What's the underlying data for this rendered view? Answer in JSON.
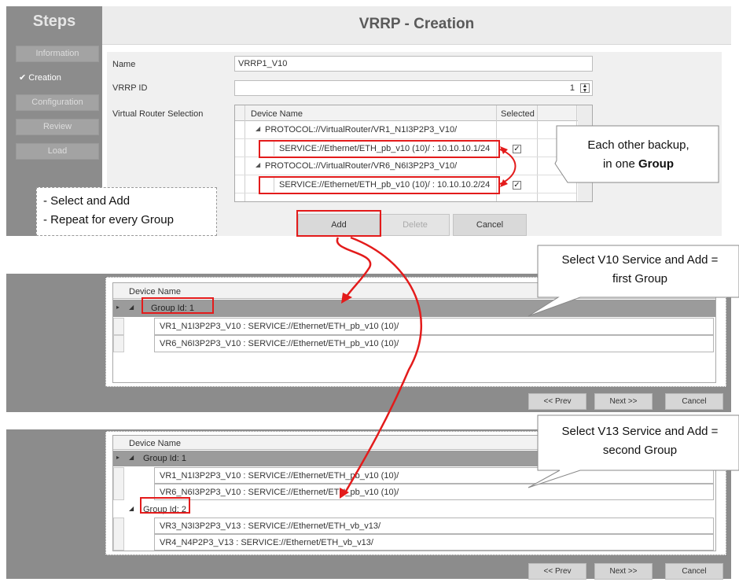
{
  "steps": {
    "title": "Steps",
    "items": [
      "Information",
      "Creation",
      "Configuration",
      "Review",
      "Load"
    ],
    "current_index": 1,
    "check_glyph": "✔"
  },
  "form": {
    "title": "VRRP - Creation",
    "name_label": "Name",
    "name_value": "VRRP1_V10",
    "vrrp_id_label": "VRRP ID",
    "vrrp_id_value": "1",
    "vrs_label": "Virtual Router Selection",
    "col_device": "Device Name",
    "col_selected": "Selected",
    "rows": [
      {
        "text": "PROTOCOL://VirtualRouter/VR1_N1I3P2P3_V10/",
        "kind": "protocol"
      },
      {
        "text": "SERVICE://Ethernet/ETH_pb_v10 (10)/ : 10.10.10.1/24",
        "kind": "service",
        "checked": true
      },
      {
        "text": "PROTOCOL://VirtualRouter/VR6_N6I3P2P3_V10/",
        "kind": "protocol"
      },
      {
        "text": "SERVICE://Ethernet/ETH_pb_v10 (10)/ : 10.10.10.2/24",
        "kind": "service",
        "checked": true
      }
    ],
    "add_label": "Add",
    "delete_label": "Delete",
    "cancel_label": "Cancel"
  },
  "panel2": {
    "col_device": "Device Name",
    "group1": "Group Id: 1",
    "g1_rows": [
      "VR1_N1I3P2P3_V10 : SERVICE://Ethernet/ETH_pb_v10 (10)/",
      "VR6_N6I3P2P3_V10 : SERVICE://Ethernet/ETH_pb_v10 (10)/"
    ],
    "prev": "<< Prev",
    "next": "Next >>",
    "cancel": "Cancel"
  },
  "panel3": {
    "col_device": "Device Name",
    "group1": "Group Id: 1",
    "g1_rows": [
      "VR1_N1I3P2P3_V10 : SERVICE://Ethernet/ETH_pb_v10 (10)/",
      "VR6_N6I3P2P3_V10 : SERVICE://Ethernet/ETH_pb_v10 (10)/"
    ],
    "group2": "Group Id: 2",
    "g2_rows": [
      "VR3_N3I3P2P3_V13 : SERVICE://Ethernet/ETH_vb_v13/",
      "VR4_N4P2P3_V13 : SERVICE://Ethernet/ETH_vb_v13/"
    ],
    "prev": "<< Prev",
    "next": "Next >>",
    "cancel": "Cancel"
  },
  "annotations": {
    "select_add_1": "- Select and Add",
    "select_add_2": "- Repeat for every Group",
    "backup_1": "Each other backup,",
    "backup_2_pre": "in one ",
    "backup_2_bold": "Group",
    "v10_1": "Select V10 Service and Add =",
    "v10_2": "first Group",
    "v13_1": "Select V13 Service and Add =",
    "v13_2": "second Group",
    "red": "#e31b1b"
  }
}
